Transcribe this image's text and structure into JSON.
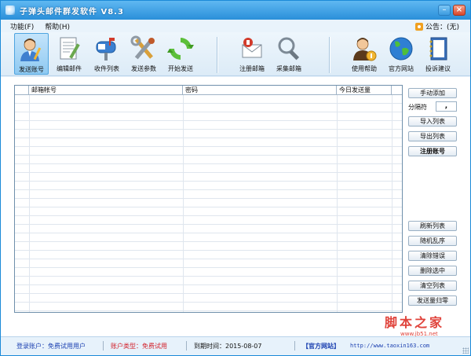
{
  "window": {
    "title": "子弹头邮件群发软件  V8.3"
  },
  "menu": {
    "items": [
      "功能(F)",
      "帮助(H)"
    ],
    "notice": "公告：(无)"
  },
  "toolbar": {
    "items": [
      {
        "label": "发送账号",
        "icon": "user-pen-icon"
      },
      {
        "label": "编辑邮件",
        "icon": "document-edit-icon"
      },
      {
        "label": "收件列表",
        "icon": "mailbox-icon"
      },
      {
        "label": "发送参数",
        "icon": "tools-icon"
      },
      {
        "label": "开始发送",
        "icon": "refresh-send-icon"
      },
      {
        "label": "注册邮箱",
        "icon": "register-mail-icon"
      },
      {
        "label": "采集邮箱",
        "icon": "magnifier-icon"
      },
      {
        "label": "使用帮助",
        "icon": "help-person-icon"
      },
      {
        "label": "官方网站",
        "icon": "globe-icon"
      },
      {
        "label": "投诉建议",
        "icon": "notebook-icon"
      }
    ]
  },
  "table": {
    "columns": [
      "",
      "邮箱帐号",
      "密码",
      "今日发送量"
    ],
    "rows": []
  },
  "side": {
    "manual_add": "手动添加",
    "separator_label": "分隔符",
    "separator_value": ",",
    "import_list": "导入列表",
    "export_list": "导出列表",
    "register_account": "注册账号",
    "refresh_list": "刷新列表",
    "shuffle": "随机乱序",
    "clear_errors": "清除错误",
    "delete_selected": "删除选中",
    "clear_list": "清空列表",
    "reset_send_count": "发送量归零"
  },
  "watermark": {
    "title": "脚本之家",
    "url": "www.jb51.net"
  },
  "status": {
    "login_account": "登录账户：免费试用用户",
    "account_type": "账户类型：免费试用",
    "expire_time": "到期时间：2015-08-07",
    "official_site": "【官方网站】",
    "site_url": "http://www.taoxin163.com"
  },
  "colors": {
    "title_bar": "#2a8fd9",
    "account_type_text": "#d2202a",
    "link_text": "#1a3fb0"
  }
}
